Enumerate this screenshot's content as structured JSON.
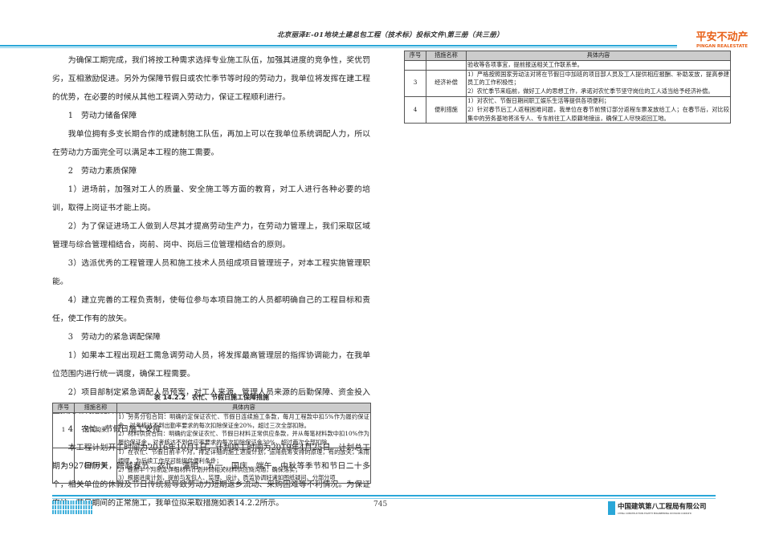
{
  "header": {
    "title": "北京丽泽E-01地块土建总包工程（技术标）投标文件\\第三册（共三册）",
    "logo_cn": "平安不动产",
    "logo_en": "PINGAN REALESTATE"
  },
  "body": [
    "为确保工期完成，我们将按工种需求选择专业施工队伍，加强其进度的竞争性，奖优罚劣，互相激励促进。另外为保障节假日或农忙季节等时段的劳动力，我单位将发挥在建工程的优势，在必要的时候从其他工程调入劳动力，保证工程顺利进行。",
    "1　劳动力储备保障",
    "我单位拥有多支长期合作的成建制施工队伍，再加上可以在我单位系统调配人力，所以在劳动力方面完全可以满足本工程的施工需要。",
    "2　劳动力素质保障",
    "1）进场前，加强对工人的质量、安全施工等方面的教育，对工人进行各种必要的培训，取得上岗证书才能上岗。",
    "2）为了保证进场工人做到人尽其才提高劳动生产力，在劳动力管理上，我们采取区域管理与综合管理相结合，岗前、岗中、岗后三位管理相结合的原则。",
    "3）选派优秀的工程管理人员和施工技术人员组成项目管理班子，对本工程实施管理职能。",
    "4）建立完善的工程负责制，使每位参与本项目施工的人员都明确自己的工程目标和责任，使工作有的放矢。",
    "3　劳动力的紧急调配保障",
    "1）如果本工程出现赶工需急调劳动人员，将发挥最高管理层的指挥协调能力，在我单位范围内进行统一调度，确保工程需要。",
    "2）项目部制定紧急调配人员预案，对工人来源、管理人员来源的后勤保障、资金投入量预先编制措施并报总经理批准。",
    "4　农忙、节假日施工安排",
    "本工程计划开工时间为2016年10月1日，计划竣工时间为2019年4月25日。计划总工期为927日历天，跨越春节、农忙、清明、五一、国庆、端午、中秋等季节和节日二十多个，相关单位的休假及节日传统易导致劳动力短期返乡流动、采购困难等不利情况。为保证农忙、节日期间的正常施工，我单位拟采取措施如表14.2.2所示。"
  ],
  "table": {
    "caption": "表 14.2.2　农忙、节假日施工保障措施",
    "headers": [
      "序号",
      "措施名称",
      "具体内容"
    ],
    "rows": [
      {
        "no": "1",
        "name": "合同约束",
        "content": "1）劳务分包合同：明确约定保证农忙、节假日连续施工条款，每月工程款中扣5%作为履约保证金，对考核达不到出勤率要求的每次扣除保证金20%，超过三次全部扣除。\n2）材料供货合同：明确约定保证农忙、节假日材料正常供应条款，并从每笔材料款中扣10%作为履约保证金，对考核达不到供应率要求的每次扣除保证金30%，超过两次全部扣除。"
      },
      {
        "no": "2",
        "name": "超前计划",
        "content": "1）在农忙、节假日前半个月，排定详细的施工进度计划，运用统筹安排的原理，有的放矢，未雨绸缪，为后续工作尽可能提供便利条件；\n2）提前半个月制定详细材料计划并同相关材料供应商沟通，确保落实；\n3）根据进度计划，提前与发包人、监理、设计、质监协调好诸如图纸疑问、分部分项"
      },
      {
        "no": "",
        "name": "",
        "content": "验收等各项事宜，提前报送相关工作联系单。"
      },
      {
        "no": "3",
        "name": "经济补偿",
        "content": "1）严格按照国家劳动法对将在节假日中加班的项目部人员及工人提供相应报酬、补助发放，提高参建员工的工作积极性；\n2）农忙季节来临前，做好工人的思想工作，承诺对农忙季节坚守岗位的工人适当给予经济补偿。"
      },
      {
        "no": "4",
        "name": "便利措施",
        "content": "1）对农忙、节假日期间职工娱乐生活等提供各项便利；\n2）针对春节后工人返程困难问题，我单位在春节前预订部分返程车票发放给工人；在春节后，对比较集中的劳务基地将派专人、专车前往工人原籍地接运，确保工人尽快返回工地。"
      }
    ]
  },
  "footer": {
    "page": "745",
    "company_cn": "中国建筑第八工程局有限公司",
    "company_en": "CHINA CONSTRUCTION EIGHTH ENGINEERING DIVISION CORP.LTD"
  },
  "colors": {
    "accent": "#2aa7d8",
    "logo": "#e8621a"
  }
}
